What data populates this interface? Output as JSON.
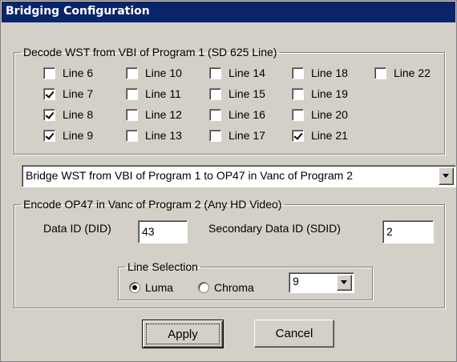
{
  "window": {
    "title": "Bridging Configuration"
  },
  "decode_group": {
    "title": "Decode WST from VBI of Program 1 (SD 625 Line)",
    "lines": [
      {
        "label": "Line 6",
        "checked": false
      },
      {
        "label": "Line 7",
        "checked": true
      },
      {
        "label": "Line 8",
        "checked": true
      },
      {
        "label": "Line 9",
        "checked": true
      },
      {
        "label": "Line 10",
        "checked": false
      },
      {
        "label": "Line 11",
        "checked": false
      },
      {
        "label": "Line 12",
        "checked": false
      },
      {
        "label": "Line 13",
        "checked": false
      },
      {
        "label": "Line 14",
        "checked": false
      },
      {
        "label": "Line 15",
        "checked": false
      },
      {
        "label": "Line 16",
        "checked": false
      },
      {
        "label": "Line 17",
        "checked": false
      },
      {
        "label": "Line 18",
        "checked": false
      },
      {
        "label": "Line 19",
        "checked": false
      },
      {
        "label": "Line 20",
        "checked": false
      },
      {
        "label": "Line 21",
        "checked": true
      },
      {
        "label": "Line 22",
        "checked": false
      }
    ]
  },
  "bridge_mode": {
    "selected": "Bridge WST from VBI of Program 1 to OP47 in Vanc of Program 2"
  },
  "encode_group": {
    "title": "Encode OP47 in Vanc of Program 2 (Any HD Video)",
    "did_label": "Data ID (DID)",
    "did_value": "43",
    "sdid_label": "Secondary Data ID (SDID)",
    "sdid_value": "2",
    "line_selection": {
      "title": "Line Selection",
      "luma_label": "Luma",
      "chroma_label": "Chroma",
      "selected": "Luma",
      "line_value": "9"
    }
  },
  "buttons": {
    "apply": "Apply",
    "cancel": "Cancel"
  }
}
